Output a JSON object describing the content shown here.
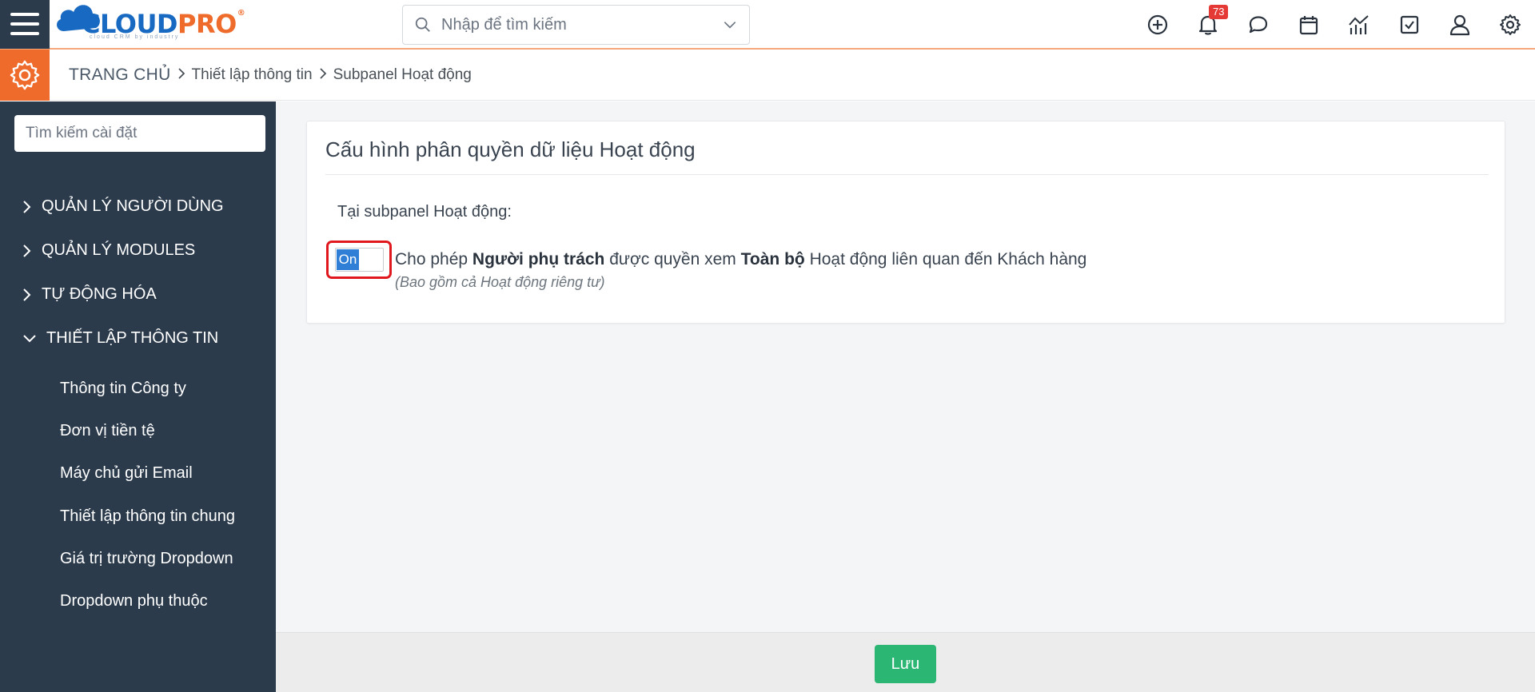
{
  "brand": {
    "logo_main": "CLOUD",
    "logo_accent": "PRO",
    "logo_tagline": "cloud CRM by industry",
    "logo_registered": "®",
    "brand_blue": "#1769c1",
    "brand_orange": "#ef6b2c"
  },
  "header": {
    "search_placeholder": "Nhập để tìm kiếm",
    "notification_count": "73",
    "icons": [
      "plus-circle-icon",
      "bell-icon",
      "chat-icon",
      "calendar-icon",
      "chart-icon",
      "checkbox-icon",
      "user-icon",
      "gear-icon"
    ]
  },
  "breadcrumb": {
    "home": "TRANG CHỦ",
    "level1": "Thiết lập thông tin",
    "level2": "Subpanel Hoạt động"
  },
  "sidebar": {
    "search_placeholder": "Tìm kiếm cài đặt",
    "groups": [
      {
        "label": "QUẢN LÝ NGƯỜI DÙNG",
        "expanded": false
      },
      {
        "label": "QUẢN LÝ MODULES",
        "expanded": false
      },
      {
        "label": "TỰ ĐỘNG HÓA",
        "expanded": false
      },
      {
        "label": "THIẾT LẬP THÔNG TIN",
        "expanded": true
      }
    ],
    "sub_items": [
      "Thông tin Công ty",
      "Đơn vị tiền tệ",
      "Máy chủ gửi Email",
      "Thiết lập thông tin chung",
      "Giá trị trường Dropdown",
      "Dropdown phụ thuộc"
    ]
  },
  "main": {
    "title": "Cấu hình phân quyền dữ liệu Hoạt động",
    "intro": "Tại subpanel Hoạt động:",
    "toggle_label": "On",
    "toggle_state": "on",
    "rule": {
      "part1": "Cho phép ",
      "bold1": "Người phụ trách",
      "part2": " được quyền xem ",
      "bold2": "Toàn bộ",
      "part3": " Hoạt động liên quan đến Khách hàng"
    },
    "note": "(Bao gồm cả Hoạt động riêng tư)"
  },
  "footer": {
    "save_label": "Lưu",
    "save_color": "#2bb673"
  }
}
